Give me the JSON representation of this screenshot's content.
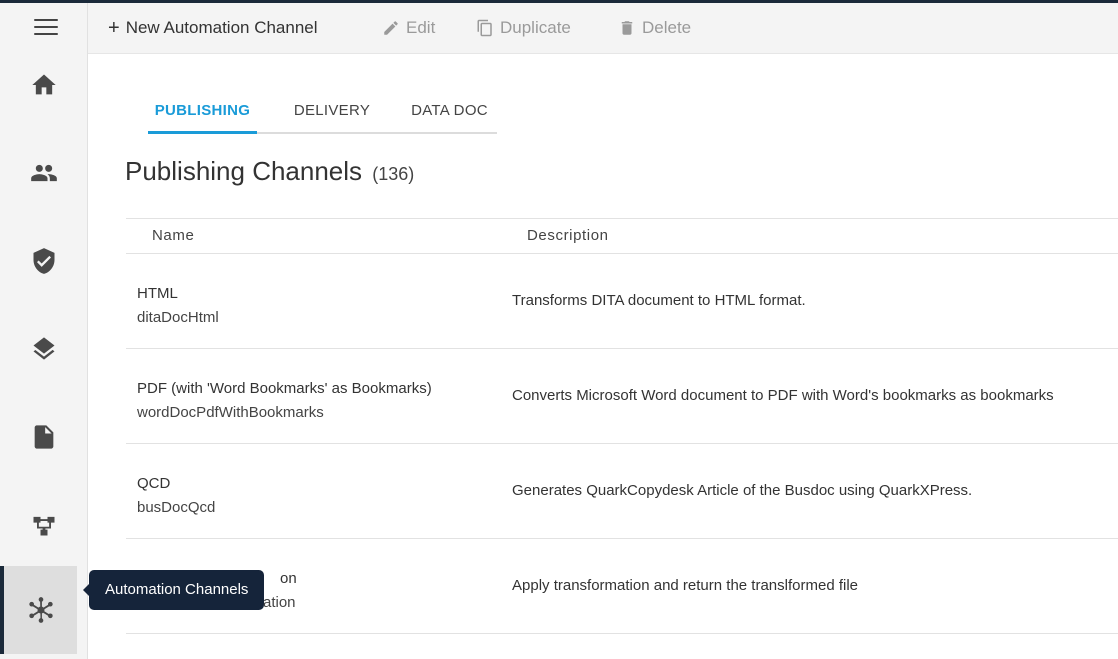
{
  "toolbar": {
    "new_label": "New Automation Channel",
    "new_icon": "plus-icon",
    "edit_label": "Edit",
    "duplicate_label": "Duplicate",
    "delete_label": "Delete"
  },
  "sidebar": {
    "items": [
      {
        "name": "home",
        "icon": "home-icon"
      },
      {
        "name": "users",
        "icon": "people-icon"
      },
      {
        "name": "security",
        "icon": "shield-check-icon"
      },
      {
        "name": "layers",
        "icon": "layers-icon"
      },
      {
        "name": "documents",
        "icon": "document-icon"
      },
      {
        "name": "workflow",
        "icon": "workflow-icon"
      },
      {
        "name": "automation-channels",
        "icon": "hub-icon",
        "active": true
      }
    ],
    "tooltip": "Automation Channels"
  },
  "tabs": [
    {
      "label": "PUBLISHING",
      "active": true
    },
    {
      "label": "DELIVERY",
      "active": false
    },
    {
      "label": "DATA DOC",
      "active": false
    }
  ],
  "page": {
    "title": "Publishing Channels",
    "count": "(136)"
  },
  "table": {
    "columns": [
      "Name",
      "Description"
    ],
    "rows": [
      {
        "title": "HTML",
        "id": "ditaDocHtml",
        "description": "Transforms DITA document to HTML format."
      },
      {
        "title": "PDF (with 'Word Bookmarks' as Bookmarks)",
        "id": "wordDocPdfWithBookmarks",
        "description": "Converts Microsoft Word document to PDF with Word's bookmarks as bookmarks"
      },
      {
        "title": "QCD",
        "id": "busDocQcd",
        "description": "Generates QuarkCopydesk Article of the Busdoc using QuarkXPress."
      },
      {
        "title": "on",
        "id": "ation",
        "description": "Apply transformation and return the translformed file"
      }
    ]
  },
  "colors": {
    "accent": "#1a9bd8",
    "dark": "#15243a"
  }
}
